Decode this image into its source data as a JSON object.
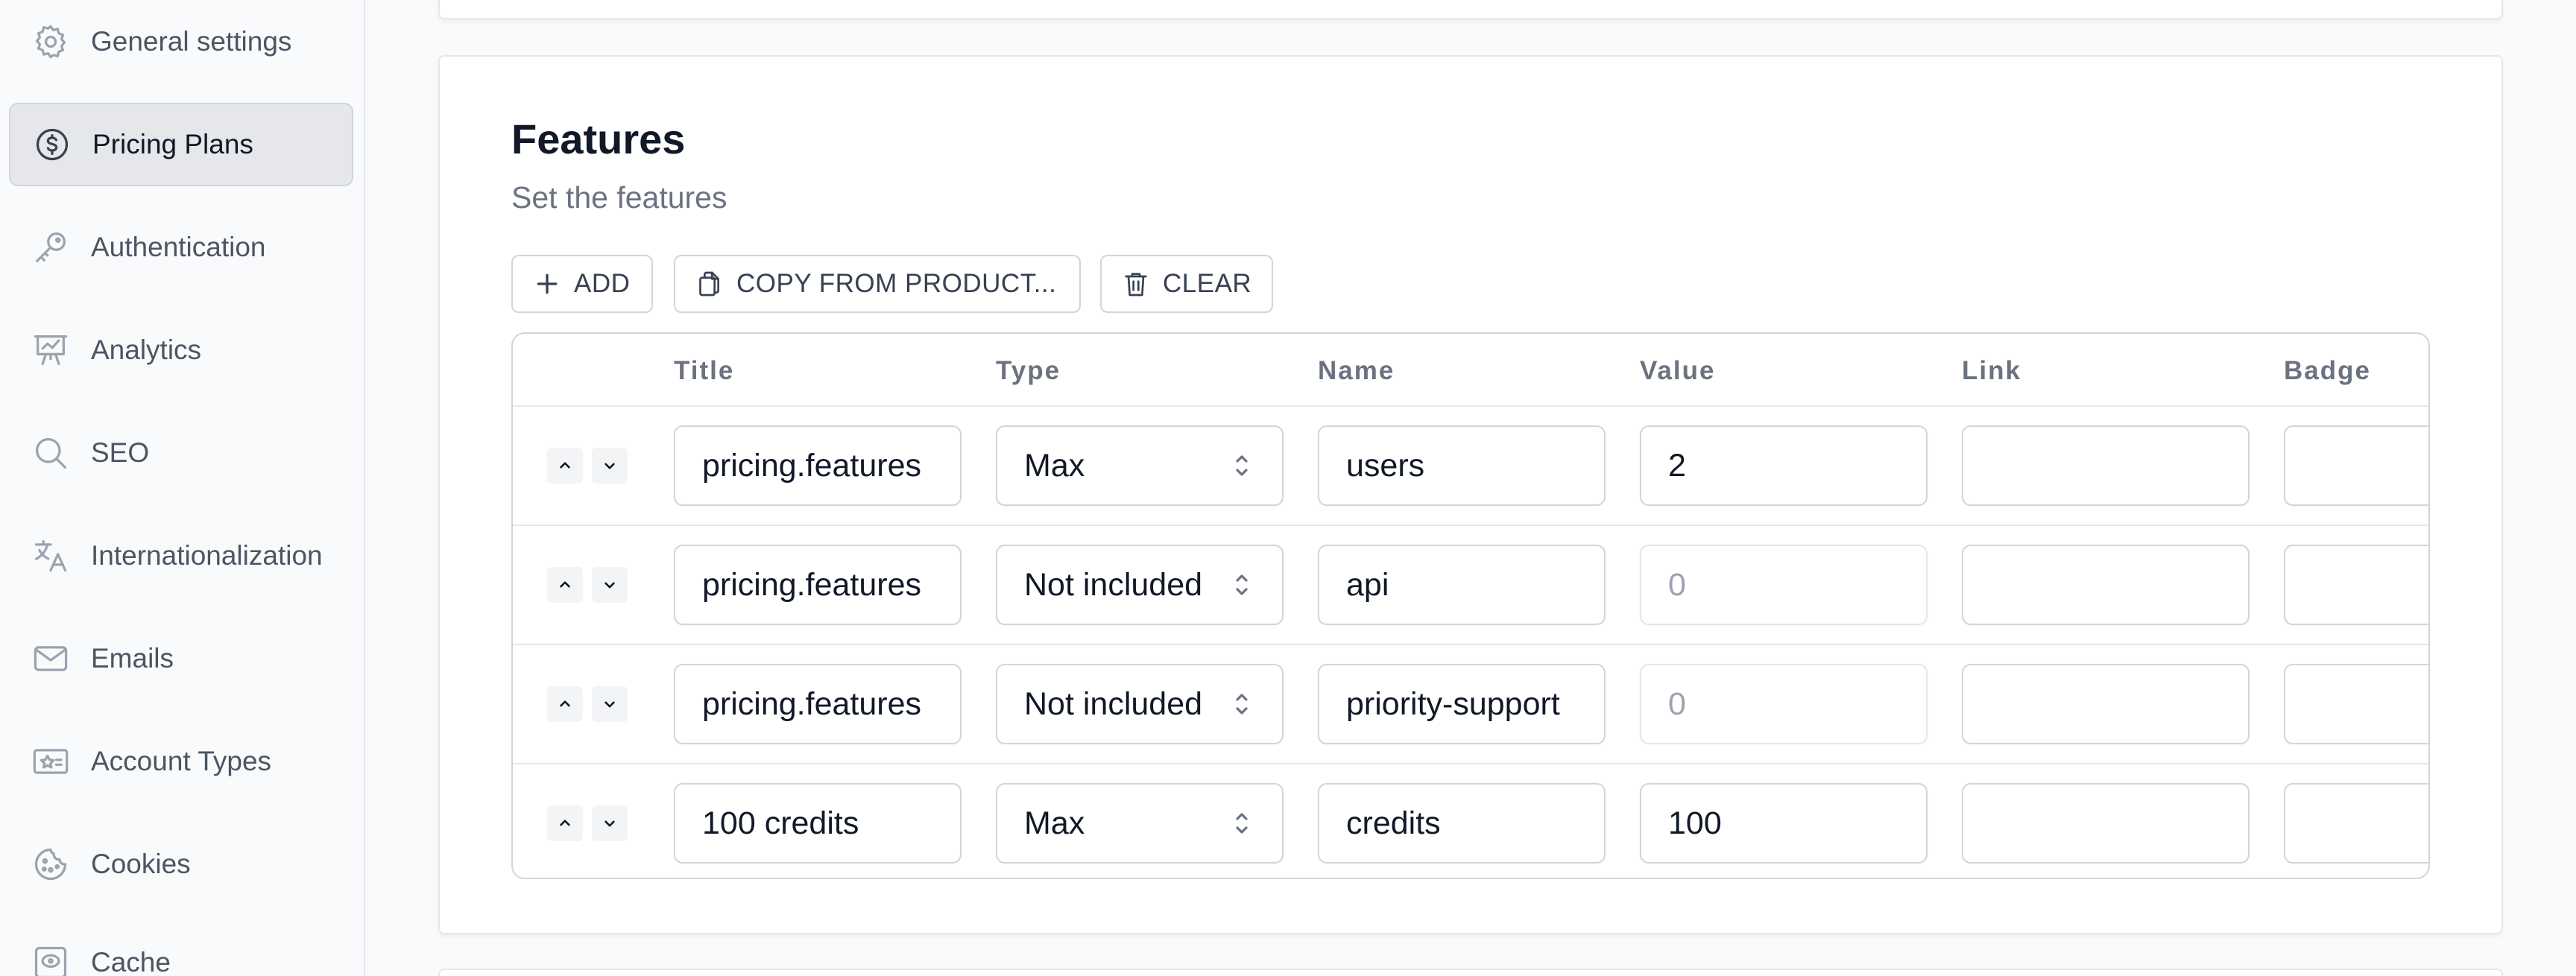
{
  "sidebar": {
    "items": [
      {
        "label": "General settings",
        "icon": "gear-icon",
        "active": false
      },
      {
        "label": "Pricing Plans",
        "icon": "dollar-circle-icon",
        "active": true
      },
      {
        "label": "Authentication",
        "icon": "key-icon",
        "active": false
      },
      {
        "label": "Analytics",
        "icon": "chart-presentation-icon",
        "active": false
      },
      {
        "label": "SEO",
        "icon": "search-icon",
        "active": false
      },
      {
        "label": "Internationalization",
        "icon": "translate-icon",
        "active": false
      },
      {
        "label": "Emails",
        "icon": "mail-icon",
        "active": false
      },
      {
        "label": "Account Types",
        "icon": "star-card-icon",
        "active": false
      },
      {
        "label": "Cookies",
        "icon": "cookie-icon",
        "active": false
      },
      {
        "label": "Cache",
        "icon": "disk-icon",
        "active": false
      }
    ]
  },
  "features": {
    "title": "Features",
    "description": "Set the features",
    "toolbar": {
      "add_label": "ADD",
      "copy_label": "COPY FROM PRODUCT...",
      "clear_label": "CLEAR"
    },
    "columns": {
      "title": "Title",
      "type": "Type",
      "name": "Name",
      "value": "Value",
      "link": "Link",
      "badge": "Badge"
    },
    "rows": [
      {
        "title": "pricing.features",
        "type": "Max",
        "name": "users",
        "value": "2",
        "value_is_placeholder": false,
        "link": "",
        "badge": ""
      },
      {
        "title": "pricing.features",
        "type": "Not included",
        "name": "api",
        "value": "0",
        "value_is_placeholder": true,
        "link": "",
        "badge": ""
      },
      {
        "title": "pricing.features",
        "type": "Not included",
        "name": "priority-support",
        "value": "0",
        "value_is_placeholder": true,
        "link": "",
        "badge": ""
      },
      {
        "title": "100 credits",
        "type": "Max",
        "name": "credits",
        "value": "100",
        "value_is_placeholder": false,
        "link": "",
        "badge": ""
      }
    ]
  }
}
